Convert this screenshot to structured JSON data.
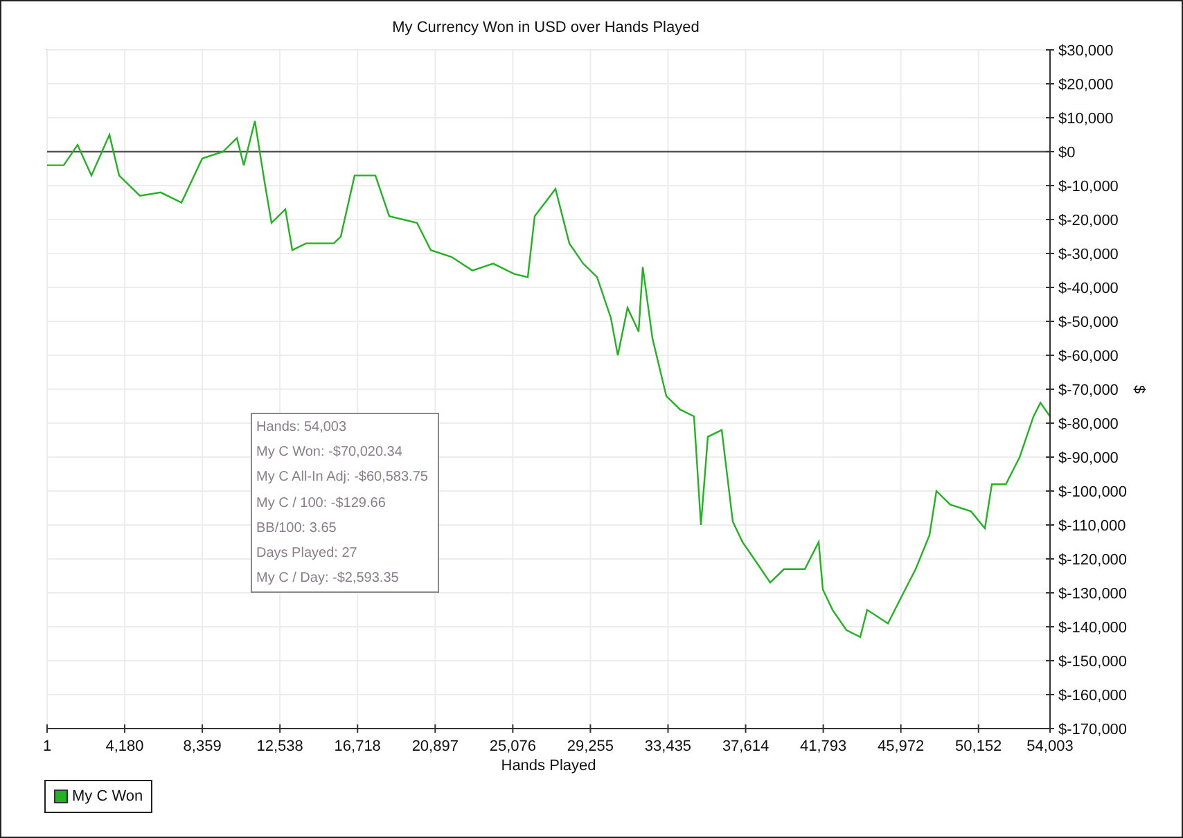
{
  "chart": {
    "chart_data": {
      "type": "line",
      "title": "My Currency Won in USD over Hands Played",
      "xlabel": "Hands Played",
      "ylabel": "$",
      "xlim": [
        1,
        54003
      ],
      "ylim": [
        -170000,
        30000
      ],
      "x": [
        1,
        895,
        1641,
        2387,
        3357,
        3879,
        4998,
        6117,
        7236,
        8355,
        9474,
        10220,
        10593,
        11190,
        11712,
        12085,
        12831,
        13204,
        13950,
        15442,
        15815,
        16561,
        17680,
        18426,
        19918,
        20664,
        21782,
        22899,
        24018,
        25137,
        25883,
        26256,
        27375,
        28121,
        28867,
        29613,
        30359,
        30732,
        31254,
        31851,
        32075,
        32597,
        33343,
        34089,
        34835,
        35208,
        35581,
        36327,
        36924,
        37446,
        38192,
        38938,
        39684,
        40803,
        41549,
        41773,
        42295,
        43041,
        43787,
        44160,
        45279,
        46025,
        46771,
        47517,
        47890,
        48636,
        49755,
        50501,
        50874,
        51620,
        52366,
        53112,
        53485,
        54003
      ],
      "grid": true,
      "series": [
        {
          "name": "My C Won",
          "color": "#22b322",
          "values": [
            -4000,
            -4000,
            2000,
            -7000,
            5000,
            -7000,
            -13000,
            -12000,
            -15000,
            -2000,
            0,
            4000,
            -4000,
            9000,
            -9000,
            -21000,
            -17000,
            -29000,
            -27000,
            -27000,
            -25000,
            -7000,
            -7000,
            -19000,
            -21000,
            -29000,
            -31000,
            -35000,
            -33000,
            -36000,
            -37000,
            -19000,
            -11000,
            -27000,
            -33000,
            -37000,
            -49000,
            -60000,
            -46000,
            -53000,
            -34000,
            -55000,
            -72000,
            -76000,
            -78000,
            -110000,
            -84000,
            -82000,
            -109000,
            -115000,
            -121000,
            -127000,
            -123000,
            -123000,
            -115000,
            -129000,
            -135000,
            -141000,
            -143000,
            -135000,
            -139000,
            -131000,
            -123000,
            -113000,
            -100000,
            -104000,
            -106000,
            -111000,
            -98000,
            -98000,
            -90000,
            -78000,
            -74000,
            -78000
          ]
        }
      ],
      "xticks": [
        {
          "value": 1,
          "label": "1"
        },
        {
          "value": 4180,
          "label": "4,180"
        },
        {
          "value": 8359,
          "label": "8,359"
        },
        {
          "value": 12538,
          "label": "12,538"
        },
        {
          "value": 16718,
          "label": "16,718"
        },
        {
          "value": 20897,
          "label": "20,897"
        },
        {
          "value": 25076,
          "label": "25,076"
        },
        {
          "value": 29255,
          "label": "29,255"
        },
        {
          "value": 33435,
          "label": "33,435"
        },
        {
          "value": 37614,
          "label": "37,614"
        },
        {
          "value": 41793,
          "label": "41,793"
        },
        {
          "value": 45972,
          "label": "45,972"
        },
        {
          "value": 50152,
          "label": "50,152"
        },
        {
          "value": 54003,
          "label": "54,003"
        }
      ],
      "yticks": [
        {
          "value": 30000,
          "label": "$30,000"
        },
        {
          "value": 20000,
          "label": "$20,000"
        },
        {
          "value": 10000,
          "label": "$10,000"
        },
        {
          "value": 0,
          "label": "$0"
        },
        {
          "value": -10000,
          "label": "$-10,000"
        },
        {
          "value": -20000,
          "label": "$-20,000"
        },
        {
          "value": -30000,
          "label": "$-30,000"
        },
        {
          "value": -40000,
          "label": "$-40,000"
        },
        {
          "value": -50000,
          "label": "$-50,000"
        },
        {
          "value": -60000,
          "label": "$-60,000"
        },
        {
          "value": -70000,
          "label": "$-70,000"
        },
        {
          "value": -80000,
          "label": "$-80,000"
        },
        {
          "value": -90000,
          "label": "$-90,000"
        },
        {
          "value": -100000,
          "label": "$-100,000"
        },
        {
          "value": -110000,
          "label": "$-110,000"
        },
        {
          "value": -120000,
          "label": "$-120,000"
        },
        {
          "value": -130000,
          "label": "$-130,000"
        },
        {
          "value": -140000,
          "label": "$-140,000"
        },
        {
          "value": -150000,
          "label": "$-150,000"
        },
        {
          "value": -160000,
          "label": "$-160,000"
        },
        {
          "value": -170000,
          "label": "$-170,000"
        }
      ]
    }
  },
  "stats_box": {
    "lines": [
      "Hands: 54,003",
      "My C Won: -$70,020.34",
      "My C All-In Adj: -$60,583.75",
      "My C / 100: -$129.66",
      "BB/100: 3.65",
      "Days Played: 27",
      "My C / Day: -$2,593.35"
    ]
  }
}
